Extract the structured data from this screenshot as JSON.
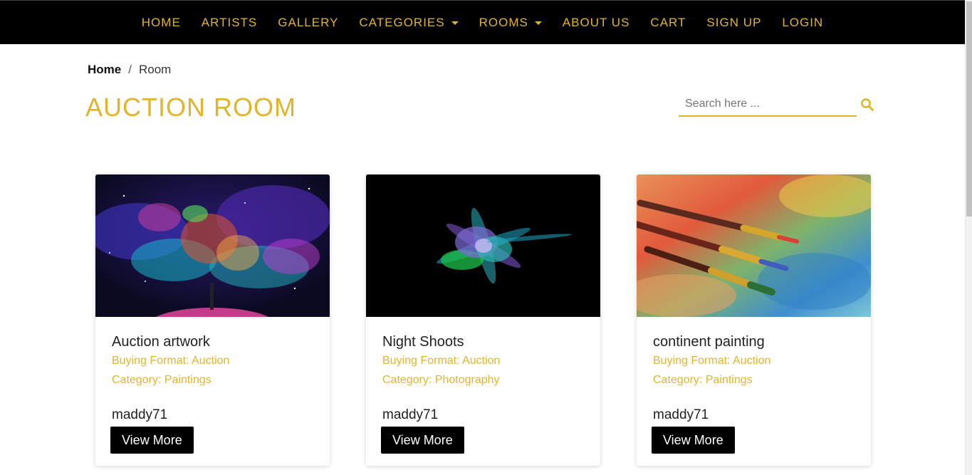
{
  "nav": {
    "items": [
      {
        "label": "HOME",
        "dropdown": false
      },
      {
        "label": "ARTISTS",
        "dropdown": false
      },
      {
        "label": "GALLERY",
        "dropdown": false
      },
      {
        "label": "CATEGORIES",
        "dropdown": true
      },
      {
        "label": "ROOMS",
        "dropdown": true
      },
      {
        "label": "ABOUT US",
        "dropdown": false
      },
      {
        "label": "CART",
        "dropdown": false
      },
      {
        "label": "SIGN UP",
        "dropdown": false
      },
      {
        "label": "LOGIN",
        "dropdown": false
      }
    ]
  },
  "breadcrumb": {
    "home": "Home",
    "separator": "/",
    "current": "Room"
  },
  "page_title": "AUCTION ROOM",
  "search": {
    "placeholder": "Search here ...",
    "value": ""
  },
  "cards": [
    {
      "title": "Auction artwork",
      "buying_format": "Buying Format: Auction",
      "category": "Category: Paintings",
      "user": "maddy71",
      "button": "View More",
      "image": "cosmic-nebula-painting"
    },
    {
      "title": "Night Shoots",
      "buying_format": "Buying Format: Auction",
      "category": "Category: Photography",
      "user": "maddy71",
      "button": "View More",
      "image": "color-powder-explosion"
    },
    {
      "title": "continent painting",
      "buying_format": "Buying Format: Auction",
      "category": "Category: Paintings",
      "user": "maddy71",
      "button": "View More",
      "image": "paint-brushes-on-palette"
    }
  ],
  "colors": {
    "accent": "#e2b42c",
    "navbar_bg": "#000000",
    "button_bg": "#000000"
  }
}
